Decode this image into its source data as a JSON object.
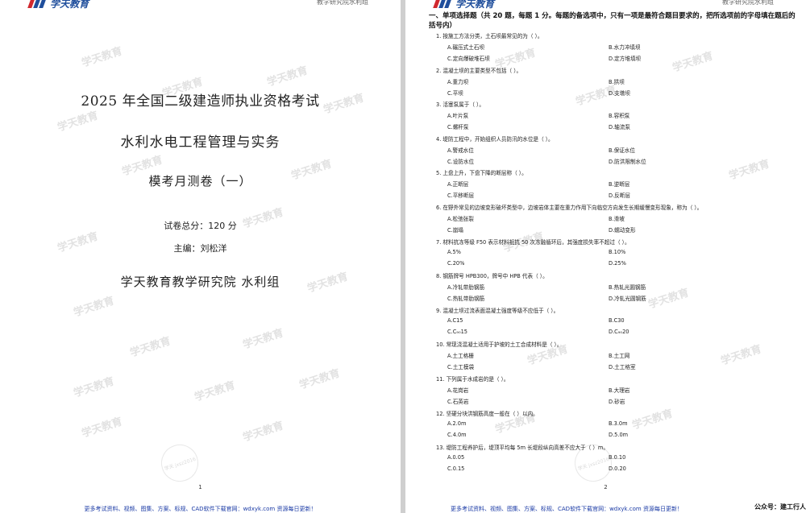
{
  "brand": {
    "logo_text": "学天教育",
    "header_right": "教学研究院水利组"
  },
  "watermark": {
    "text": "学天教育",
    "stamp_text": "学天 jxsz2016"
  },
  "cover": {
    "exam_title": "2025 年全国二级建造师执业资格考试",
    "subject": "水利水电工程管理与实务",
    "paper_name": "模考月测卷（一）",
    "score": "试卷总分：120 分",
    "editor": "主编：刘松洋",
    "org": "学天教育教学研究院  水利组",
    "page_number": "1",
    "footer": "更多考试资料、视频、图集、方案、标规、CAD软件下载官网：wdxyk.com 资源每日更新！"
  },
  "questions_page": {
    "section_heading": "一、单项选择题（共 20 题，每题 1 分。每题的备选项中，只有一项是最符合题目要求的，把所选项前的字母填在题后的括号内）",
    "page_number": "2",
    "footer": "更多考试资料、视频、图集、方案、标规、CAD软件下载官网：wdxyk.com 资源每日更新！",
    "public_account": "公众号：建工行人",
    "questions": [
      {
        "stem": "1.  按施工方法分类，土石坝最常见的为（     ）。",
        "a": "A.碾压式土石坝",
        "b": "B.水力冲填坝",
        "c": "C.定向爆破堆石坝",
        "d": "D.定方堆填坝"
      },
      {
        "stem": "2.  混凝土坝的主要类型不包括（     ）。",
        "a": "A.重力坝",
        "b": "B.拱坝",
        "c": "C.平坝",
        "d": "D.支墩坝"
      },
      {
        "stem": "3.  活塞泵属于（     ）。",
        "a": "A.叶片泵",
        "b": "B.容积泵",
        "c": "C.螺杆泵",
        "d": "D.轴流泵"
      },
      {
        "stem": "4.  堤防工程中，开始组织人员防汛的水位是（     ）。",
        "a": "A.警戒水位",
        "b": "B.保证水位",
        "c": "C.设防水位",
        "d": "D.防洪限制水位"
      },
      {
        "stem": "5.  上盘上升，下盘下降的断层称（     ）。",
        "a": "A.正断层",
        "b": "B.逆断层",
        "c": "C.平移断层",
        "d": "D.反断层"
      },
      {
        "stem": "6.  在野外常见的边坡变形破坏类型中，边坡岩体主要在重力作用下向临空方向发生长期缓慢变形现象，称为（     ）。",
        "a": "A.松弛张裂",
        "b": "B.滑坡",
        "c": "C.崩塌",
        "d": "D.蠕动变形"
      },
      {
        "stem": "7.  材料抗冻等级 F50 表示材料抵抗 50 次冻融循环后，其强度损失率不超过（     ）。",
        "a": "A.5%",
        "b": "B.10%",
        "c": "C.20%",
        "d": "D.25%"
      },
      {
        "stem": "8.  钢筋牌号 HPB300，牌号中 HPB 代表（     ）。",
        "a": "A.冷轧带肋钢筋",
        "b": "B.热轧光圆钢筋",
        "c": "C.热轧带肋钢筋",
        "d": "D.冷轧光圆钢筋"
      },
      {
        "stem": "9.  混凝土坝过流表面混凝土强度等级不应低于（     ）。",
        "a": "A.C15",
        "b": "B.C30",
        "c": "C.C₉₀15",
        "d": "D.C₉₀20"
      },
      {
        "stem": "10.  常现浇混凝土适用于护坡的土工合成材料是（     ）。",
        "a": "A.土工格栅",
        "b": "B.土工网",
        "c": "C.土工模袋",
        "d": "D.土工格室"
      },
      {
        "stem": "11.  下列属于水成岩的是（     ）。",
        "a": "A.花岗岩",
        "b": "B.大理岩",
        "c": "C.石英岩",
        "d": "D.砂岩"
      },
      {
        "stem": "12.  坚硬分块洪钢筋高度一般在（     ）以内。",
        "a": "A.2.0m",
        "b": "B.3.0m",
        "c": "C.4.0m",
        "d": "D.5.0m"
      },
      {
        "stem": "13.  堤防工程养护后，堤顶平均每 5m 长堤段纵向高差不应大于（     ）m。",
        "a": "A.0.05",
        "b": "B.0.10",
        "c": "C.0.15",
        "d": "D.0.20"
      }
    ]
  }
}
